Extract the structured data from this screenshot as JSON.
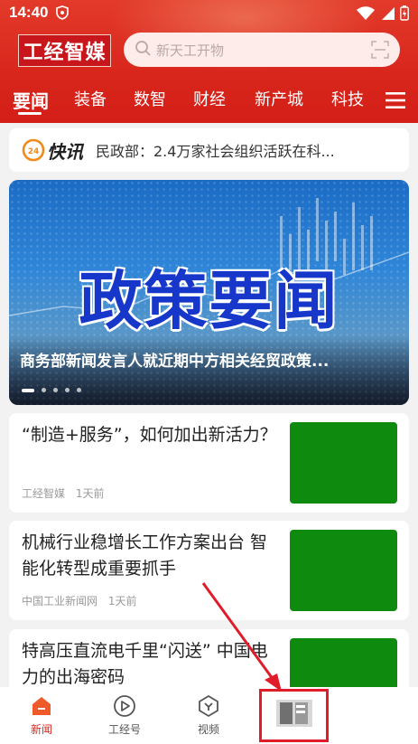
{
  "status_bar": {
    "time": "14:40"
  },
  "header": {
    "logo_text": "工经智媒",
    "search_placeholder": "新天工开物",
    "tabs": [
      "要闻",
      "装备",
      "数智",
      "财经",
      "新产城",
      "科技"
    ],
    "active_tab": "要闻"
  },
  "flash": {
    "title": "快讯",
    "text": "民政部：2.4万家社会组织活跃在科..."
  },
  "banner": {
    "headline": "政策要闻",
    "caption": "商务部新闻发言人就近期中方相关经贸政策..."
  },
  "news": [
    {
      "title": "“制造+服务”，如何加出新活力？",
      "source": "工经智媒",
      "time": "1天前"
    },
    {
      "title": "机械行业稳增长工作方案出台 智能化转型成重要抓手",
      "source": "中国工业新闻网",
      "time": "1天前"
    },
    {
      "title": "特高压直流电千里“闪送” 中国电力的出海密码",
      "source": "",
      "time": ""
    }
  ],
  "bottom_nav": {
    "items": [
      {
        "label": "新闻",
        "icon": "home-icon"
      },
      {
        "label": "工经号",
        "icon": "play-circle-icon"
      },
      {
        "label": "视频",
        "icon": "video-icon"
      },
      {
        "label": "",
        "icon": "newspaper-icon"
      }
    ],
    "active": "新闻"
  },
  "colors": {
    "brand_red": "#d9261c",
    "thumb_green": "#0e8a0e",
    "annotation_red": "#e01b2a"
  }
}
